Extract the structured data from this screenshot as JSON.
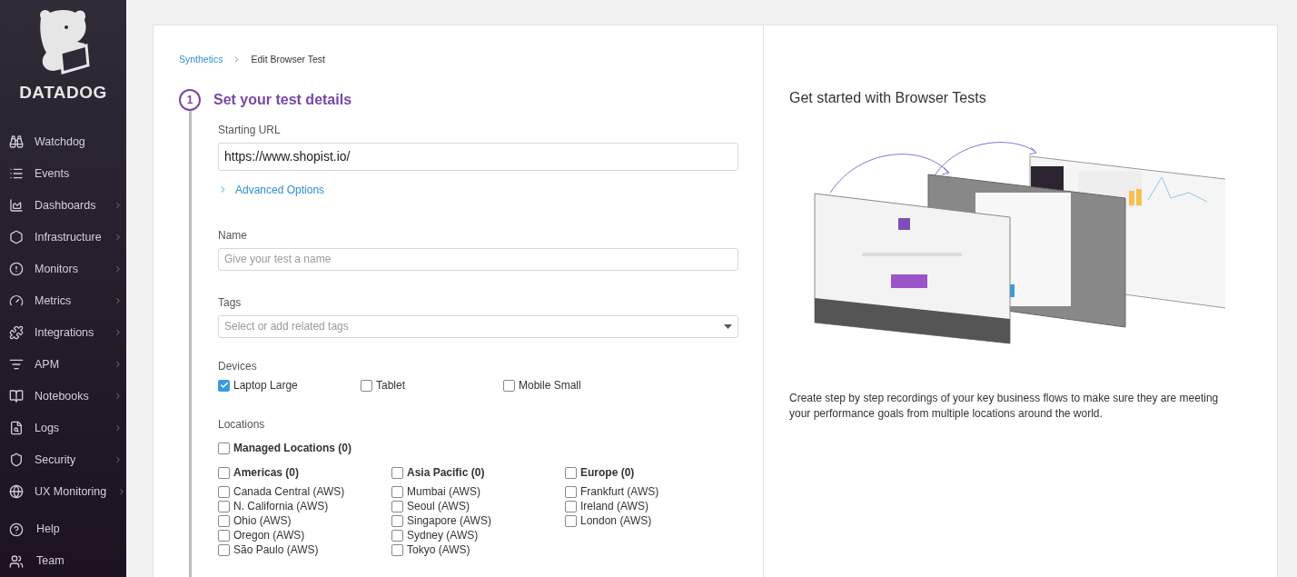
{
  "sidebar": {
    "logo_text": "DATADOG",
    "items": [
      {
        "label": "Watchdog",
        "expandable": false
      },
      {
        "label": "Events",
        "expandable": false
      },
      {
        "label": "Dashboards",
        "expandable": true
      },
      {
        "label": "Infrastructure",
        "expandable": true
      },
      {
        "label": "Monitors",
        "expandable": true
      },
      {
        "label": "Metrics",
        "expandable": true
      },
      {
        "label": "Integrations",
        "expandable": true
      },
      {
        "label": "APM",
        "expandable": true
      },
      {
        "label": "Notebooks",
        "expandable": true
      },
      {
        "label": "Logs",
        "expandable": true
      },
      {
        "label": "Security",
        "expandable": true
      },
      {
        "label": "UX Monitoring",
        "expandable": true
      }
    ],
    "bottom_items": [
      {
        "label": "Help"
      },
      {
        "label": "Team"
      }
    ]
  },
  "breadcrumb": [
    {
      "label": "Synthetics",
      "link": true
    },
    {
      "label": "Edit Browser Test",
      "link": false
    }
  ],
  "step": {
    "number": "1",
    "title": "Set your test details"
  },
  "starting_url": {
    "label": "Starting URL",
    "value": "https://www.shopist.io/"
  },
  "advanced_options": {
    "label": "Advanced Options",
    "expanded": false
  },
  "name": {
    "label": "Name",
    "placeholder": "Give your test a name"
  },
  "tags": {
    "label": "Tags",
    "placeholder": "Select or add related tags"
  },
  "devices": {
    "label": "Devices",
    "options": [
      {
        "label": "Laptop Large",
        "checked": true
      },
      {
        "label": "Tablet",
        "checked": false
      },
      {
        "label": "Mobile Small",
        "checked": false
      }
    ]
  },
  "locations": {
    "label": "Locations",
    "managed": {
      "label": "Managed Locations (0)",
      "checked": false
    },
    "regions": [
      {
        "label": "Americas (0)",
        "checked": false,
        "items": [
          {
            "label": "Canada Central (AWS)",
            "checked": false
          },
          {
            "label": "N. California (AWS)",
            "checked": false
          },
          {
            "label": "Ohio (AWS)",
            "checked": false
          },
          {
            "label": "Oregon (AWS)",
            "checked": false
          },
          {
            "label": "São Paulo (AWS)",
            "checked": false
          }
        ]
      },
      {
        "label": "Asia Pacific (0)",
        "checked": false,
        "items": [
          {
            "label": "Mumbai (AWS)",
            "checked": false
          },
          {
            "label": "Seoul (AWS)",
            "checked": false
          },
          {
            "label": "Singapore (AWS)",
            "checked": false
          },
          {
            "label": "Sydney (AWS)",
            "checked": false
          },
          {
            "label": "Tokyo (AWS)",
            "checked": false
          }
        ]
      },
      {
        "label": "Europe (0)",
        "checked": false,
        "items": [
          {
            "label": "Frankfurt (AWS)",
            "checked": false
          },
          {
            "label": "Ireland (AWS)",
            "checked": false
          },
          {
            "label": "London (AWS)",
            "checked": false
          }
        ]
      }
    ]
  },
  "side_panel": {
    "title": "Get started with Browser Tests",
    "description": "Create step by step recordings of your key business flows to make sure they are meeting your performance goals from multiple locations around the world."
  }
}
